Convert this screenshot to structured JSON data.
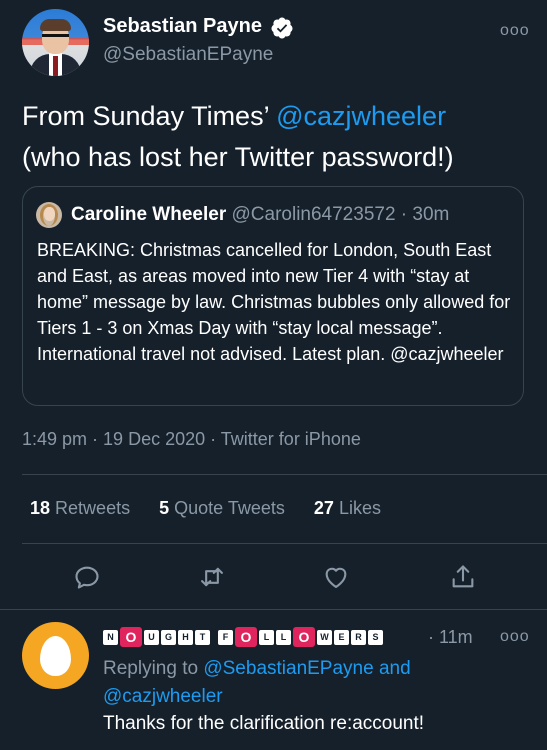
{
  "author": {
    "name": "Sebastian Payne",
    "handle": "@SebastianEPayne",
    "verified": true
  },
  "tweet": {
    "text_prefix": "From Sunday Times’ ",
    "mention": "@cazjwheeler",
    "text_suffix": "(who has lost her Twitter password!)"
  },
  "quote": {
    "name": "Caroline Wheeler",
    "handle": "@Carolin64723572",
    "time": "· 30m",
    "text": "BREAKING: Christmas cancelled for London, South East and East, as areas moved into new Tier 4 with “stay at home” message by law. Christmas bubbles only allowed for Tiers 1 - 3 on Xmas Day with “stay local message”. International travel not advised. Latest plan. @cazjwheeler"
  },
  "meta": {
    "time": "1:49 pm",
    "date": "19 Dec 2020",
    "source": "Twitter for iPhone"
  },
  "stats": {
    "retweets_count": "18",
    "retweets_label": "Retweets",
    "quotes_count": "5",
    "quotes_label": "Quote Tweets",
    "likes_count": "27",
    "likes_label": "Likes"
  },
  "reply": {
    "name_letters": [
      "N",
      "O",
      "U",
      "G",
      "H",
      "T",
      " ",
      "F",
      "O",
      "L",
      "L",
      "O",
      "W",
      "E",
      "R",
      "S"
    ],
    "time": "· 11m",
    "replying_prefix": "Replying to ",
    "replying_user1": "@SebastianEPayne",
    "replying_and": " and ",
    "replying_user2": "@cazjwheeler",
    "text": "Thanks for the clarification re:account!"
  },
  "icons": {
    "more": "more-horizontal-icon",
    "reply": "reply-icon",
    "retweet": "retweet-icon",
    "like": "like-icon",
    "share": "share-icon",
    "verified": "verified-badge-icon"
  },
  "colors": {
    "background": "#15202b",
    "accent": "#1d9bf0",
    "muted": "#8b98a5",
    "divider": "#38444d",
    "default_avatar": "#f5a623"
  },
  "more_glyph": "ooo"
}
